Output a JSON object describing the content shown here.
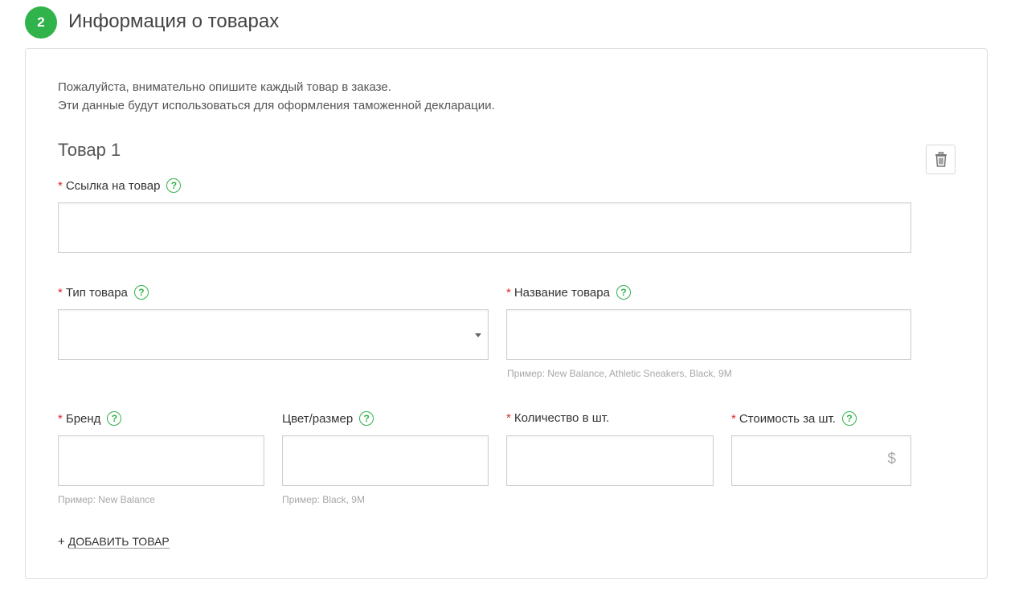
{
  "section": {
    "step_number": "2",
    "title": "Информация о товарах"
  },
  "intro": {
    "line1": "Пожалуйста, внимательно опишите каждый товар в заказе.",
    "line2": "Эти данные будут использоваться для оформления таможенной декларации."
  },
  "item": {
    "title": "Товар 1",
    "delete_icon": "trash-icon"
  },
  "fields": {
    "link": {
      "label": "Ссылка на товар",
      "required": true,
      "value": ""
    },
    "type": {
      "label": "Тип товара",
      "required": true,
      "value": ""
    },
    "name": {
      "label": "Название товара",
      "required": true,
      "value": "",
      "hint": "Пример: New Balance, Athletic Sneakers, Black, 9M"
    },
    "brand": {
      "label": "Бренд",
      "required": true,
      "value": "",
      "hint": "Пример: New Balance"
    },
    "color_size": {
      "label": "Цвет/размер",
      "required": false,
      "value": "",
      "hint": "Пример: Black, 9M"
    },
    "quantity": {
      "label": "Количество в шт.",
      "required": true,
      "value": ""
    },
    "price": {
      "label": "Стоимость за шт.",
      "required": true,
      "value": "",
      "currency": "$"
    }
  },
  "required_mark": "*",
  "help_glyph": "?",
  "add_item": {
    "plus": "+",
    "label": "Добавить товар"
  },
  "colors": {
    "accent": "#2fb34a",
    "required": "#e0262b"
  }
}
